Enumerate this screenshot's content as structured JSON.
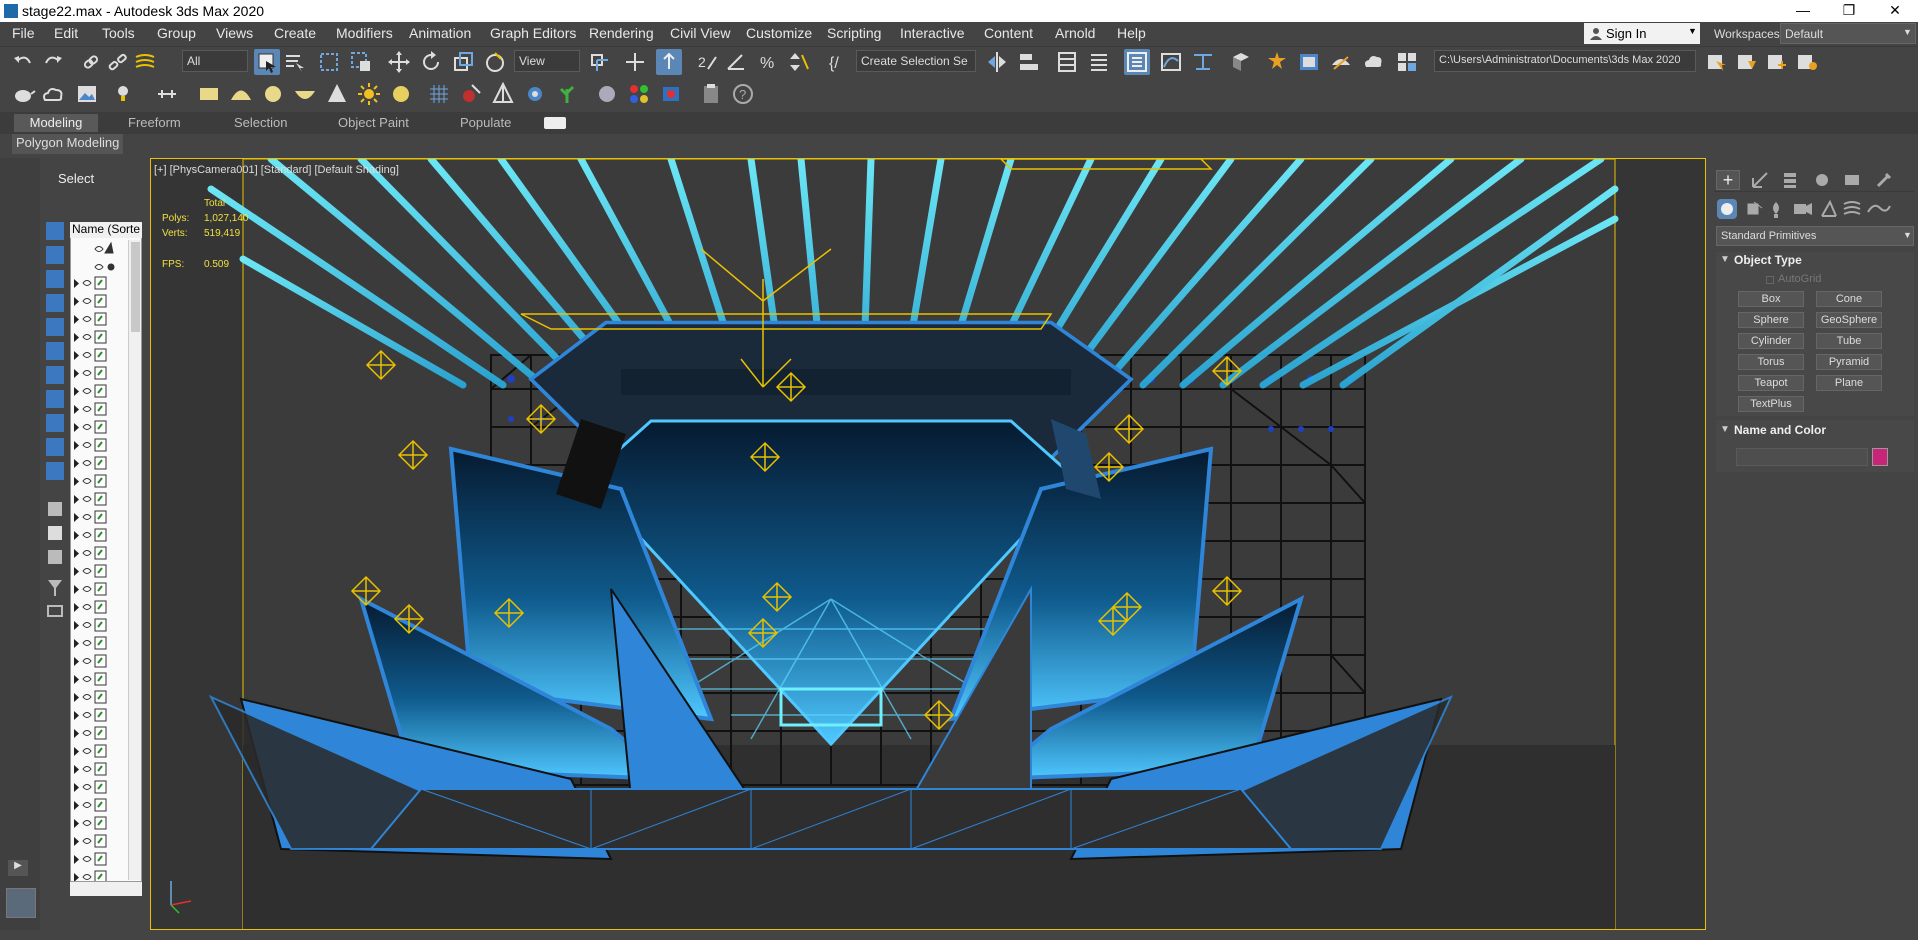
{
  "window": {
    "title": "stage22.max - Autodesk 3ds Max 2020",
    "minimize": "—",
    "restore": "❐",
    "close": "✕"
  },
  "menu": [
    "File",
    "Edit",
    "Tools",
    "Group",
    "Views",
    "Create",
    "Modifiers",
    "Animation",
    "Graph Editors",
    "Rendering",
    "Civil View",
    "Customize",
    "Scripting",
    "Interactive",
    "Content",
    "Arnold",
    "Help"
  ],
  "signin": {
    "label": "Sign In"
  },
  "workspaces": {
    "label": "Workspaces:",
    "value": "Default"
  },
  "toolbar": {
    "selection_filter": "All",
    "reference_coord": "View",
    "named_selection": "Create Selection Se",
    "project_path": "C:\\Users\\Administrator\\Documents\\3ds Max 2020"
  },
  "ribbon": {
    "tabs": [
      "Modeling",
      "Freeform",
      "Selection",
      "Object Paint",
      "Populate"
    ],
    "active": "Modeling",
    "panel": "Polygon Modeling"
  },
  "scene_explorer": {
    "select_label": "Select",
    "column_header": "Name (Sorte"
  },
  "viewport": {
    "label": "[+] [PhysCamera001] [Standard] [Default Shading]",
    "stats": {
      "total_label": "Total",
      "polys_label": "Polys:",
      "polys_value": "1,027,140",
      "verts_label": "Verts:",
      "verts_value": "519,419",
      "fps_label": "FPS:",
      "fps_value": "0.509"
    }
  },
  "command_panel": {
    "category": "Standard Primitives",
    "object_type_title": "Object Type",
    "autogrid": "AutoGrid",
    "buttons": [
      "Box",
      "Cone",
      "Sphere",
      "GeoSphere",
      "Cylinder",
      "Tube",
      "Torus",
      "Pyramid",
      "Teapot",
      "Plane",
      "TextPlus"
    ],
    "name_color_title": "Name and Color",
    "color": "#c8247a"
  },
  "colors": {
    "accent": "#5b87b6",
    "viewport_border": "#e8c100",
    "beam": "#4fe6ff",
    "stage_blue": "#2f86d8"
  }
}
